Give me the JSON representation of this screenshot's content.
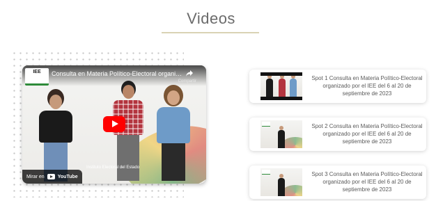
{
  "section": {
    "title": "Videos"
  },
  "player": {
    "channel_logo": "IEE",
    "title": "Consulta en Materia Político-Electoral organizado ...",
    "share_label": "Compartir",
    "watch_on_label": "Mirar en",
    "youtube_wordmark": "YouTube",
    "caption": "Instituto Electoral del Estado",
    "play_button_color": "#ff0000"
  },
  "playlist": [
    {
      "title": "Spot 1 Consulta en Materia Político-Electoral organizado por el IEE del 6 al 20 de septiembre de 2023"
    },
    {
      "title": "Spot 2 Consulta en Materia Político-Electoral organizado por el IEE del 6 al 20 de septiembre de 2023"
    },
    {
      "title": "Spot 3 Consulta en Materia Político-Electoral organizado por el IEE del 6 al 20 de septiembre de 2023"
    }
  ],
  "colors": {
    "accent_line": "#d9d3b4",
    "title_text": "#6b6b6b"
  }
}
